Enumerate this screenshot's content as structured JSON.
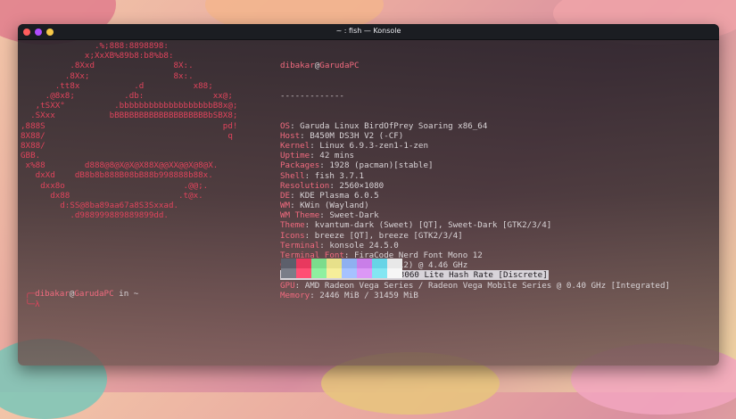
{
  "window": {
    "title": "~ : fish — Konsole"
  },
  "logo_lines": [
    "               .%;888:8898898:",
    "             x;XxXB%89b8:b8%b8:",
    "          .8Xxd                8X:.",
    "         .8Xx;                 8x:.",
    "       .tt8x           .d          x88;",
    "     .@8x8;          .db:              xx@;",
    "   ,tSXX°          .bbbbbbbbbbbbbbbbbbbB8x@;",
    "  .SXxx           bBBBBBBBBBBBBBBBBBBBbSBX8;",
    ",888S                                    pd!",
    "8X88/                                     q",
    "8X88/",
    "GBB.",
    " x%88        d888@8@X@X@X88X@@XX@@X@8@X.",
    "   dxXd    dB8b8b888B08bB88b998888b88x.",
    "    dxx8o                        .@@;.",
    "      dx88                      .t@x.",
    "        d:SS@8ba89aa67a8S3Sxxad.",
    "          .d988999889889899dd."
  ],
  "info": {
    "user": "dibakar",
    "at": "@",
    "host": "GarudaPC",
    "separator": "-------------",
    "fields": [
      {
        "key": "OS",
        "value": "Garuda Linux BirdOfPrey Soaring x86_64"
      },
      {
        "key": "Host",
        "value": "B450M DS3H V2 (-CF)"
      },
      {
        "key": "Kernel",
        "value": "Linux 6.9.3-zen1-1-zen"
      },
      {
        "key": "Uptime",
        "value": "42 mins"
      },
      {
        "key": "Packages",
        "value": "1928 (pacman)[stable]"
      },
      {
        "key": "Shell",
        "value": "fish 3.7.1"
      },
      {
        "key": "Resolution",
        "value": "2560×1080"
      },
      {
        "key": "DE",
        "value": "KDE Plasma 6.0.5"
      },
      {
        "key": "WM",
        "value": "KWin (Wayland)"
      },
      {
        "key": "WM Theme",
        "value": "Sweet-Dark"
      },
      {
        "key": "Theme",
        "value": "kvantum-dark (Sweet) [QT], Sweet-Dark [GTK2/3/4]"
      },
      {
        "key": "Icons",
        "value": "breeze [QT], breeze [GTK2/3/4]"
      },
      {
        "key": "Terminal",
        "value": "konsole 24.5.0"
      },
      {
        "key": "Terminal Font",
        "value": "FiraCode Nerd Font Mono 12"
      },
      {
        "key": "CPU",
        "value": "AMD Ryzen 5 5600G (12) @ 4.46 GHz"
      },
      {
        "key": "GPU",
        "value": "NVIDIA GeForce RTX 3060 Lite Hash Rate [Discrete]",
        "selected": true
      },
      {
        "key": "GPU",
        "value": "AMD Radeon Vega Series / Radeon Vega Mobile Series @ 0.40 GHz [Integrated]"
      },
      {
        "key": "Memory",
        "value": "2446 MiB / 31459 MiB"
      }
    ]
  },
  "swatch_colors": [
    "#5c5f6b",
    "#e8395e",
    "#7bdc8c",
    "#e7e08a",
    "#8fb0f0",
    "#c97ee8",
    "#67d4e6",
    "#e8e8e8",
    "#7a7d88",
    "#ff4f74",
    "#8ef0a0",
    "#f6ee9a",
    "#a6c2ff",
    "#dc98f6",
    "#83e6f2",
    "#f6f6f6"
  ],
  "prompt": {
    "corner": "╭─",
    "user": "dibakar",
    "at": "@",
    "host": "GarudaPC",
    "suffix": " in ~",
    "line2": "╰─λ"
  }
}
